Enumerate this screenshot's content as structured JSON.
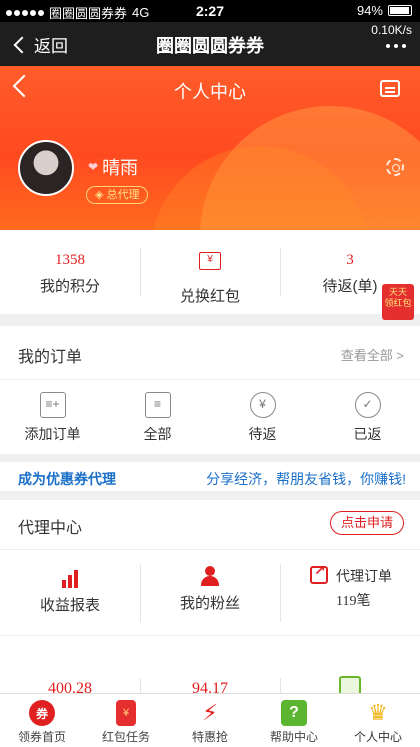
{
  "status_bar": {
    "carrier": "圈圈圆圆券券",
    "network": "4G",
    "time": "2:27",
    "battery": "94%"
  },
  "app_bar": {
    "back_label": "返回",
    "title": "圈圈圆圆券券",
    "speed": "0.10K/s"
  },
  "header": {
    "title": "个人中心",
    "username": "晴雨",
    "role": "总代理"
  },
  "stats": [
    {
      "value": "1358",
      "label": "我的积分"
    },
    {
      "value": "",
      "label": "兑换红包"
    },
    {
      "value": "3",
      "label": "待返(单)"
    }
  ],
  "red_tag": {
    "line1": "天天",
    "line2": "领红包"
  },
  "orders": {
    "title": "我的订单",
    "view_all": "查看全部 >",
    "items": [
      {
        "label": "添加订单",
        "icon": "add-order-icon"
      },
      {
        "label": "全部",
        "icon": "clipboard-icon"
      },
      {
        "label": "待返",
        "icon": "refund-icon"
      },
      {
        "label": "已返",
        "icon": "user-check-icon"
      }
    ]
  },
  "promo": {
    "left": "成为优惠券代理",
    "right": "分享经济，帮朋友省钱，你赚钱!"
  },
  "agent": {
    "title": "代理中心",
    "apply": "点击申请",
    "items": [
      {
        "label": "收益报表",
        "icon": "chart-icon"
      },
      {
        "label": "我的粉丝",
        "icon": "fans-icon"
      },
      {
        "label": "代理订单",
        "count": "119笔",
        "icon": "share-icon"
      }
    ],
    "values": [
      "400.28",
      "94.17",
      ""
    ]
  },
  "tabs": [
    {
      "label": "领券首页",
      "icon": "coupon-icon"
    },
    {
      "label": "红包任务",
      "icon": "red-packet-icon"
    },
    {
      "label": "特惠抢",
      "icon": "flash-icon"
    },
    {
      "label": "帮助中心",
      "icon": "help-icon"
    },
    {
      "label": "个人中心",
      "icon": "crown-icon"
    }
  ],
  "colors": {
    "accent": "#ff5c2a",
    "red": "#e02020",
    "link": "#1a6fc8",
    "green": "#5cb531",
    "gold": "#f2b61c"
  }
}
